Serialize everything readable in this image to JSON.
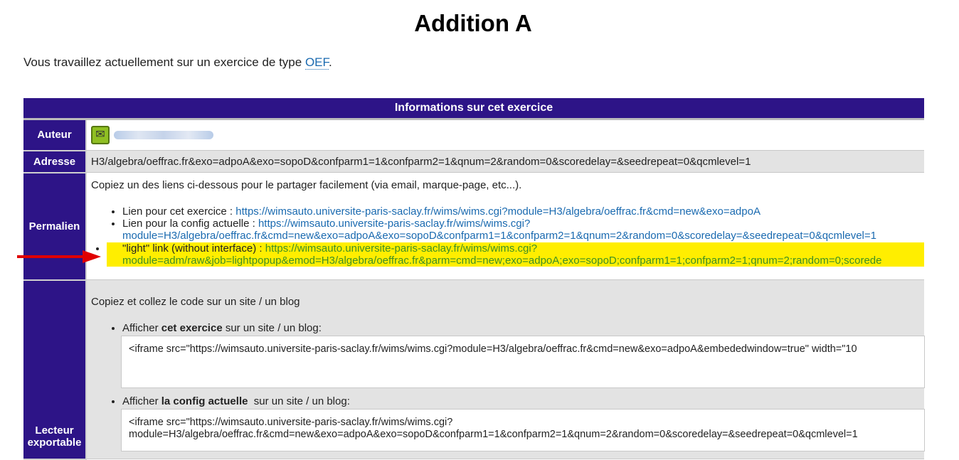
{
  "page": {
    "title": "Addition A",
    "intro_prefix": "Vous travaillez actuellement sur un exercice de type ",
    "intro_link": "OEF",
    "intro_suffix": "."
  },
  "table": {
    "header": "Informations sur cet exercice",
    "auteur_label": "Auteur",
    "adresse_label": "Adresse",
    "adresse_value": "H3/algebra/oeffrac.fr&exo=adpoA&exo=sopoD&confparm1=1&confparm2=1&qnum=2&random=0&scoredelay=&seedrepeat=0&qcmlevel=1",
    "permalien_label": "Permalien",
    "permalien_intro": "Copiez un des liens ci-dessous pour le partager facilement (via email, marque-page, etc...).",
    "links": [
      {
        "label": "Lien pour cet exercice : ",
        "url": "https://wimsauto.universite-paris-saclay.fr/wims/wims.cgi?module=H3/algebra/oeffrac.fr&cmd=new&exo=adpoA"
      },
      {
        "label": "Lien pour la config actuelle : ",
        "url": "https://wimsauto.universite-paris-saclay.fr/wims/wims.cgi?module=H3/algebra/oeffrac.fr&cmd=new&exo=adpoA&exo=sopoD&confparm1=1&confparm2=1&qnum=2&random=0&scoredelay=&seedrepeat=0&qcmlevel=1"
      },
      {
        "label": "\"light\" link (without interface) : ",
        "url": "https://wimsauto.universite-paris-saclay.fr/wims/wims.cgi?module=adm/raw&job=lightpopup&emod=H3/algebra/oeffrac.fr&parm=cmd=new;exo=adpoA;exo=sopoD;confparm1=1;confparm2=1;qnum=2;random=0;scorede"
      }
    ],
    "lecteur_label": "Lecteur exportable",
    "lecteur_intro": "Copiez et collez le code sur un site / un blog",
    "embed1_prefix": "Afficher ",
    "embed1_bold": "cet exercice",
    "embed1_suffix": " sur un site / un blog:",
    "embed1_code": "<iframe src=\"https://wimsauto.universite-paris-saclay.fr/wims/wims.cgi?module=H3/algebra/oeffrac.fr&cmd=new&exo=adpoA&embededwindow=true\" width=\"10",
    "embed2_prefix": "Afficher ",
    "embed2_bold": "la config actuelle",
    "embed2_suffix": "  sur un site / un blog:",
    "embed2_code": "<iframe src=\"https://wimsauto.universite-paris-saclay.fr/wims/wims.cgi?module=H3/algebra/oeffrac.fr&cmd=new&exo=adpoA&exo=sopoD&confparm1=1&confparm2=1&qnum=2&random=0&scoredelay=&seedrepeat=0&qcmlevel=1"
  },
  "icons": {
    "mail": "mail-icon",
    "arrow": "red-arrow-icon"
  },
  "colors": {
    "header_bg": "#2d1487",
    "highlight": "#ffee00",
    "link": "#1a6ab0",
    "arrow": "#e00000"
  }
}
